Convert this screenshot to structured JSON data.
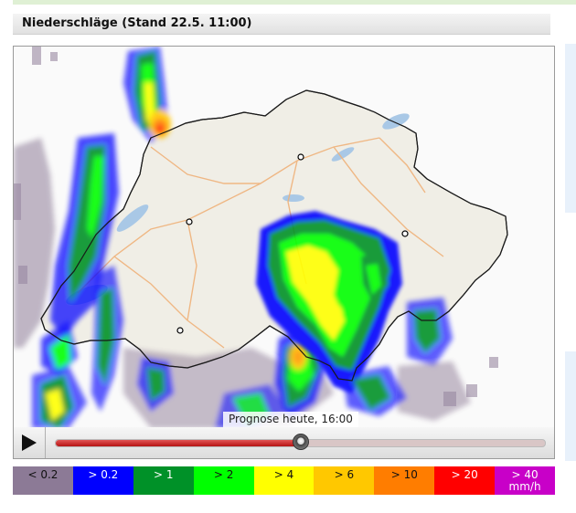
{
  "header": {
    "title": "Niederschläge (Stand 22.5. 11:00)"
  },
  "map": {
    "time_label": "Prognose heute, 16:00"
  },
  "player": {
    "progress": 0.5
  },
  "icons": {
    "play": "play-icon"
  },
  "legend": [
    {
      "label": "< 0.2",
      "color": "#8c7a96",
      "text": "#111111"
    },
    {
      "label": "> 0.2",
      "color": "#0000ff",
      "text": "#ffffff"
    },
    {
      "label": "> 1",
      "color": "#009128",
      "text": "#ffffff"
    },
    {
      "label": "> 2",
      "color": "#00ff00",
      "text": "#111111"
    },
    {
      "label": "> 4",
      "color": "#ffff00",
      "text": "#111111"
    },
    {
      "label": "> 6",
      "color": "#ffc800",
      "text": "#111111"
    },
    {
      "label": "> 10",
      "color": "#ff7d00",
      "text": "#111111"
    },
    {
      "label": "> 20",
      "color": "#ff0000",
      "text": "#ffffff"
    },
    {
      "label": "> 40 mm/h",
      "color": "#c800c8",
      "text": "#ffffff"
    }
  ]
}
